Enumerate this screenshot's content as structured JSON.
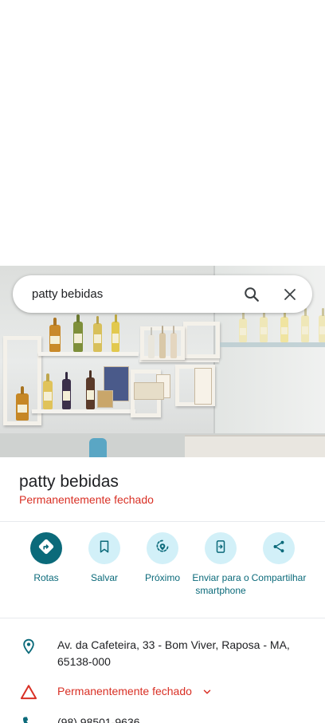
{
  "search": {
    "query": "patty bebidas"
  },
  "place": {
    "name": "patty bebidas",
    "status": "Permanentemente fechado"
  },
  "actions": [
    {
      "label": "Rotas",
      "icon": "directions-icon"
    },
    {
      "label": "Salvar",
      "icon": "bookmark-icon"
    },
    {
      "label": "Próximo",
      "icon": "nearby-icon"
    },
    {
      "label": "Enviar para o smartphone",
      "icon": "send-to-phone-icon"
    },
    {
      "label": "Compartilhar",
      "icon": "share-icon"
    }
  ],
  "details": {
    "address_line1": "Av. da Cafeteira, 33 - Bom Viver, Raposa - MA,",
    "address_line2": "65138-000",
    "closed_status": "Permanentemente fechado",
    "phone": "(98) 98501-9636"
  },
  "colors": {
    "accent": "#0b6a7a",
    "accent_light": "#d2f0f8",
    "error": "#d93025",
    "divider": "#e8eaed"
  }
}
